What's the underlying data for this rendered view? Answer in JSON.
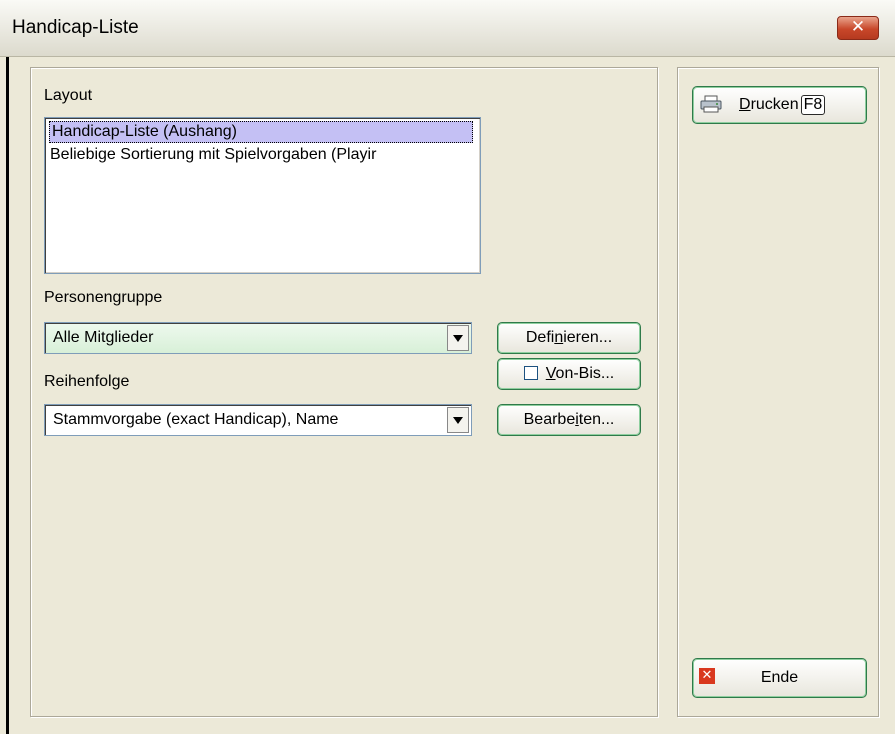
{
  "window": {
    "title": "Handicap-Liste",
    "close_glyph": "✕"
  },
  "layout": {
    "label": "Layout",
    "items": [
      {
        "label": "Handicap-Liste (Aushang)",
        "selected": true
      },
      {
        "label": "Beliebige Sortierung mit Spielvorgaben (Playir",
        "selected": false
      }
    ]
  },
  "personengruppe": {
    "label": "Personengruppe",
    "value": "Alle Mitglieder"
  },
  "reihenfolge": {
    "label": "Reihenfolge",
    "value": "Stammvorgabe (exact Handicap), Name"
  },
  "buttons": {
    "definieren": {
      "pre": "Defi",
      "accel": "n",
      "post": "ieren..."
    },
    "von_bis": {
      "pre": "",
      "accel": "V",
      "post": "on-Bis...",
      "checked": false
    },
    "bearbeiten": {
      "pre": "Bearbe",
      "accel": "i",
      "post": "ten..."
    },
    "drucken": {
      "pre": "",
      "accel": "D",
      "post": "rucken",
      "shortcut": "F8"
    },
    "ende": {
      "label": "Ende"
    }
  },
  "colors": {
    "combo_green": "#d8f0d8",
    "accent_green": "#2f7a4a",
    "selection": "#c4c0f4"
  },
  "icons": {
    "drucken": "printer-icon",
    "ende": "close-icon",
    "dropdown": "chevron-down-icon"
  }
}
